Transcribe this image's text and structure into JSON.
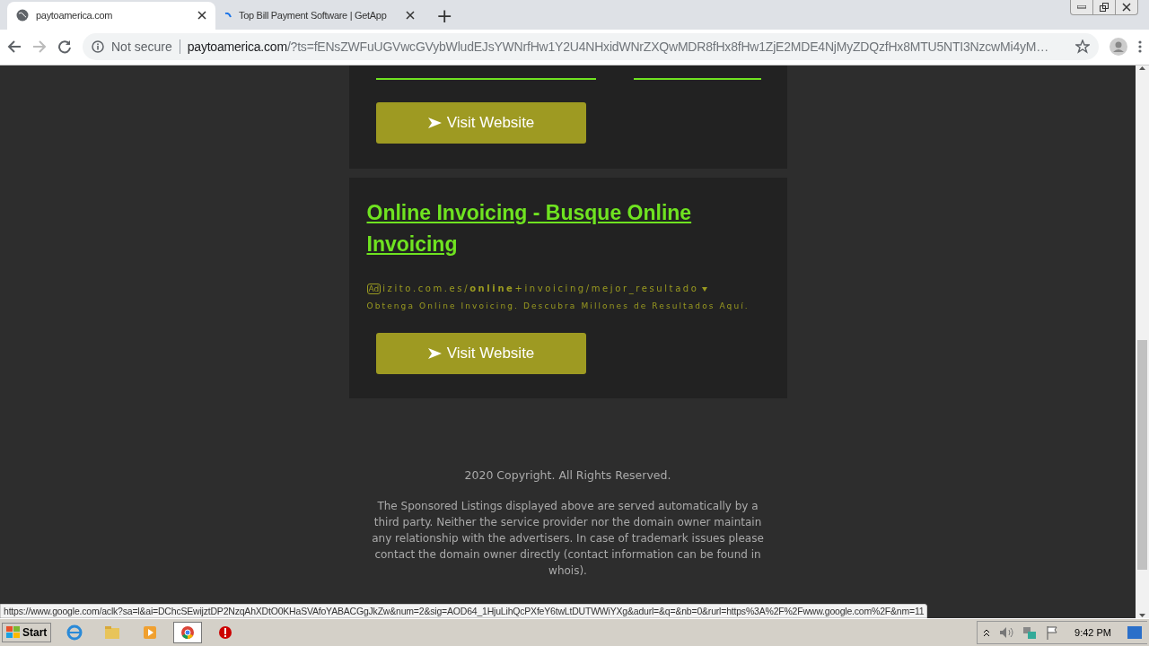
{
  "browser": {
    "tabs": [
      {
        "title": "paytoamerica.com",
        "selected": true,
        "loading": false
      },
      {
        "title": "Top Bill Payment Software | GetApp",
        "selected": false,
        "loading": true
      }
    ],
    "new_tab": "+",
    "security": "Not secure",
    "url_host": "paytoamerica.com",
    "url_rest": "/?ts=fENsZWFuUGVwcGVybWludEJsYWNrfHw1Y2U4NHxidWNrZXQwMDR8fHx8fHw1ZjE2MDE4NjMyZDQzfHx8MTU5NTI3NzcwMi4yM…"
  },
  "ads": [
    {
      "kind": "partial",
      "button": "Visit Website"
    },
    {
      "kind": "full",
      "title": "Online Invoicing - Busque Online Invoicing",
      "badge": "Ad",
      "url": "izito.com.es/**online**+invoicing/mejor_resultado",
      "description": "Obtenga Online Invoicing. Descubra Millones de Resultados Aquí.",
      "button": "Visit Website"
    }
  ],
  "footer": {
    "copyright": "2020 Copyright. All Rights Reserved.",
    "disclaimer": "The Sponsored Listings displayed above are served automatically by a third party. Neither the service provider nor the domain owner maintain any relationship with the advertisers. In case of trademark issues please contact the domain owner directly (contact information can be found in whois)."
  },
  "status_url": "https://www.google.com/aclk?sa=l&ai=DChcSEwijztDP2NzqAhXDtO0KHaSVAfoYABACGgJkZw&num=2&sig=AOD64_1HjuLihQcPXfeY6twLtDUTWWiYXg&adurl=&q=&nb=0&rurl=https%3A%2F%2Fwww.google.com%2F&nm=11",
  "taskbar": {
    "start": "Start",
    "apps": [
      {
        "kind": "ie",
        "selected": false
      },
      {
        "kind": "folder",
        "selected": false
      },
      {
        "kind": "media",
        "selected": false
      },
      {
        "kind": "chrome",
        "selected": true
      },
      {
        "kind": "stop",
        "selected": false
      }
    ],
    "clock": "9:42 PM"
  }
}
